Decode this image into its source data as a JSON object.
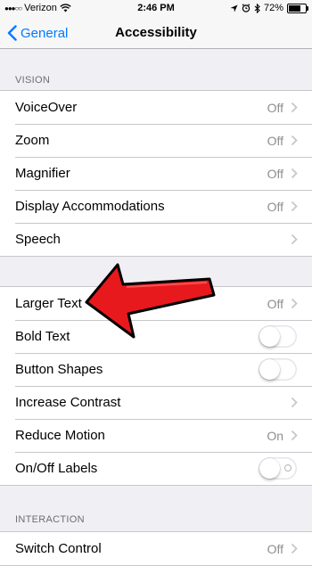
{
  "status_bar": {
    "carrier": "Verizon",
    "time": "2:46 PM",
    "battery": "72%",
    "battery_level": 0.72
  },
  "nav": {
    "back_label": "General",
    "title": "Accessibility"
  },
  "sections": {
    "vision_header": "VISION",
    "interaction_header": "INTERACTION"
  },
  "rows": {
    "voiceover": {
      "label": "VoiceOver",
      "value": "Off"
    },
    "zoom": {
      "label": "Zoom",
      "value": "Off"
    },
    "magnifier": {
      "label": "Magnifier",
      "value": "Off"
    },
    "display_accommodations": {
      "label": "Display Accommodations",
      "value": "Off"
    },
    "speech": {
      "label": "Speech"
    },
    "larger_text": {
      "label": "Larger Text",
      "value": "Off"
    },
    "bold_text": {
      "label": "Bold Text",
      "on": false
    },
    "button_shapes": {
      "label": "Button Shapes",
      "on": false
    },
    "increase_contrast": {
      "label": "Increase Contrast"
    },
    "reduce_motion": {
      "label": "Reduce Motion",
      "value": "On"
    },
    "onoff_labels": {
      "label": "On/Off Labels",
      "on": false
    },
    "switch_control": {
      "label": "Switch Control",
      "value": "Off"
    }
  },
  "colors": {
    "accent": "#007aff",
    "annotation_arrow": "#e8191d"
  },
  "icons": [
    "signal-dots-icon",
    "wifi-icon",
    "location-arrow-icon",
    "alarm-clock-icon",
    "bluetooth-icon",
    "battery-icon",
    "back-chevron-icon",
    "chevron-right-icon",
    "red-arrow-annotation-icon"
  ]
}
